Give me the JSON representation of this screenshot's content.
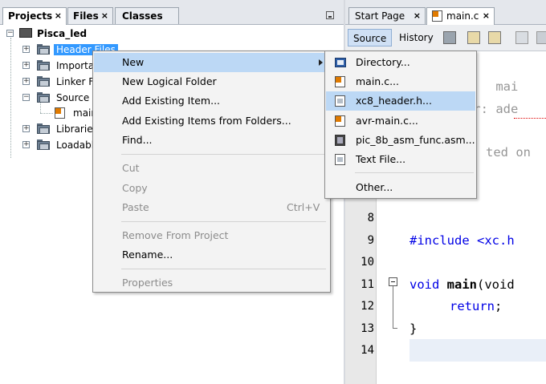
{
  "left_tabs": [
    {
      "label": "Projects",
      "close": "×",
      "active": true
    },
    {
      "label": "Files",
      "close": "×",
      "active": false
    },
    {
      "label": "Classes",
      "close": "",
      "active": false
    }
  ],
  "tree": {
    "project": "Pisca_led",
    "nodes": [
      {
        "label": "Header Files",
        "selected": true
      },
      {
        "label": "Importa"
      },
      {
        "label": "Linker Fi"
      },
      {
        "label": "Source F"
      },
      {
        "label": "main"
      },
      {
        "label": "Libraries"
      },
      {
        "label": "Loadable"
      }
    ]
  },
  "context_menu": {
    "items": [
      {
        "label": "New",
        "submenu": true,
        "highlighted": true
      },
      {
        "label": "New Logical Folder"
      },
      {
        "label": "Add Existing Item..."
      },
      {
        "label": "Add Existing Items from Folders..."
      },
      {
        "label": "Find..."
      },
      {
        "label": "Cut",
        "disabled": true
      },
      {
        "label": "Copy",
        "disabled": true
      },
      {
        "label": "Paste",
        "shortcut": "Ctrl+V",
        "disabled": true
      },
      {
        "label": "Remove From Project",
        "disabled": true
      },
      {
        "label": "Rename..."
      },
      {
        "label": "Properties",
        "disabled": true
      }
    ]
  },
  "new_submenu": {
    "items": [
      {
        "label": "Directory...",
        "icon": "directory-icon"
      },
      {
        "label": "main.c...",
        "icon": "c-file-icon"
      },
      {
        "label": "xc8_header.h...",
        "icon": "header-file-icon",
        "highlighted": true
      },
      {
        "label": "avr-main.c...",
        "icon": "c-file-icon"
      },
      {
        "label": "pic_8b_asm_func.asm...",
        "icon": "asm-file-icon"
      },
      {
        "label": "Text File...",
        "icon": "text-file-icon"
      },
      {
        "label": "Other...",
        "icon": ""
      }
    ]
  },
  "editor": {
    "tabs": [
      {
        "label": "Start Page",
        "close": "×",
        "active": false
      },
      {
        "label": "main.c",
        "close": "×",
        "active": true
      }
    ],
    "toolbar": {
      "source": "Source",
      "history": "History"
    },
    "lines": [
      {
        "num": "",
        "text": ":   mai"
      },
      {
        "num": "",
        "text": "or: ade"
      },
      {
        "num": "",
        "text": "ted on"
      },
      {
        "num": "8",
        "text": ""
      },
      {
        "num": "9",
        "text": "#include <xc.h"
      },
      {
        "num": "10",
        "text": ""
      },
      {
        "num": "11",
        "kw": "void",
        "fn": "main",
        "rest": "(void"
      },
      {
        "num": "12",
        "kw": "return",
        "rest": ";"
      },
      {
        "num": "13",
        "text": "}"
      },
      {
        "num": "14",
        "text": ""
      }
    ]
  }
}
